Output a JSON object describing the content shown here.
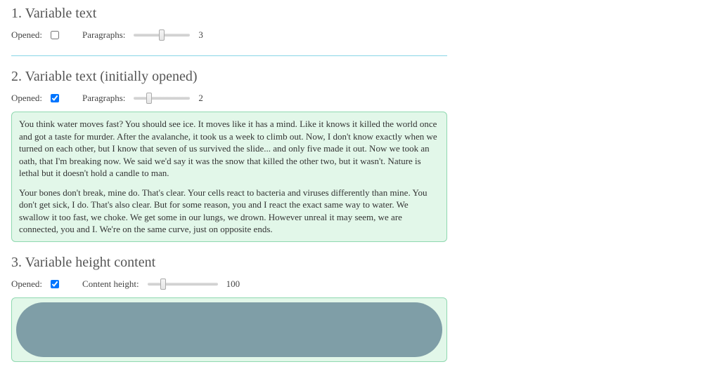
{
  "sections": [
    {
      "title": "1. Variable text",
      "opened_label": "Opened:",
      "opened": false,
      "slider_label": "Paragraphs:",
      "slider_value": 3
    },
    {
      "title": "2. Variable text (initially opened)",
      "opened_label": "Opened:",
      "opened": true,
      "slider_label": "Paragraphs:",
      "slider_value": 2,
      "paragraphs": [
        "You think water moves fast? You should see ice. It moves like it has a mind. Like it knows it killed the world once and got a taste for murder. After the avalanche, it took us a week to climb out. Now, I don't know exactly when we turned on each other, but I know that seven of us survived the slide... and only five made it out. Now we took an oath, that I'm breaking now. We said we'd say it was the snow that killed the other two, but it wasn't. Nature is lethal but it doesn't hold a candle to man.",
        "Your bones don't break, mine do. That's clear. Your cells react to bacteria and viruses differently than mine. You don't get sick, I do. That's also clear. But for some reason, you and I react the exact same way to water. We swallow it too fast, we choke. We get some in our lungs, we drown. However unreal it may seem, we are connected, you and I. We're on the same curve, just on opposite ends."
      ]
    },
    {
      "title": "3. Variable height content",
      "opened_label": "Opened:",
      "opened": true,
      "slider_label": "Content height:",
      "slider_value": 100
    }
  ]
}
